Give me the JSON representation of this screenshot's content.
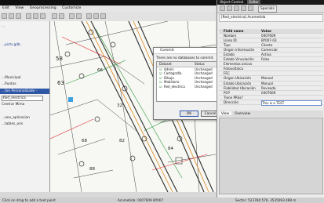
{
  "menubar": {
    "items": [
      "Edit",
      "View",
      "Geoprocessing",
      "Customize"
    ]
  },
  "left_panel": {
    "lines": [
      "...",
      "...picts.gdb",
      "...Municipal",
      "...Puntos"
    ],
    "header": "...ton Personalizado - Tool_electric...",
    "layer_select": "Red_electrica",
    "tree": [
      "Centrar Mima",
      "...ano_aplicacion",
      "...tables_aris"
    ]
  },
  "map": {
    "labels": [
      "570",
      "58",
      "63",
      "66",
      "32",
      "82",
      "84",
      "88",
      "68"
    ]
  },
  "dialog": {
    "title": "Commit",
    "message": "There are no databases to commit.",
    "columns": [
      "Dataset",
      "Status"
    ],
    "rows": [
      {
        "name": "Admin",
        "status": "Unchanged"
      },
      {
        "name": "Cartografia",
        "status": "Unchanged"
      },
      {
        "name": "Dibujo",
        "status": "Unchanged"
      },
      {
        "name": "Mobiliario",
        "status": "Unchanged"
      },
      {
        "name": "Red_electrica",
        "status": "Unchanged"
      }
    ],
    "ok_label": "OK",
    "cancel_label": "Cancel"
  },
  "object_panel": {
    "tabs": [
      "Object Control",
      "Editor"
    ],
    "specials_label": "Specials",
    "path": "[Red_electrica] Acometida",
    "columns": [
      "Field name",
      "Value"
    ],
    "rows": [
      {
        "key": "Nombre",
        "value": "0407609"
      },
      {
        "key": "Línea ID",
        "value": "BY007-03"
      },
      {
        "key": "Tipo",
        "value": "Cliente"
      },
      {
        "key": "Origen información",
        "value": "Comercial"
      },
      {
        "key": "Estado",
        "value": "Activa"
      },
      {
        "key": "Estado Vinculación",
        "value": "False"
      },
      {
        "key": "Elementos únicos",
        "value": ""
      },
      {
        "key": "Fotovoltaica",
        "value": ""
      },
      {
        "key": "FEC",
        "value": ""
      },
      {
        "key": "Origen Ubicación",
        "value": "Manual"
      },
      {
        "key": "Estado Ubicación",
        "value": "Manual"
      },
      {
        "key": "Fiabilidad Ubicación",
        "value": "Revisada"
      },
      {
        "key": "PCP",
        "value": "0407609"
      },
      {
        "key": "Tiene PRSs?",
        "value": ""
      },
      {
        "key": "Dirección",
        "value": "This is a TEST"
      }
    ],
    "bottom_tabs": [
      "View",
      "Overview"
    ]
  },
  "statusbar": {
    "left": "Click on drag to add a text point",
    "middle": "Acometida: 0407609  BY007",
    "right": "Sector: 523780.576, 3535093.489 m"
  }
}
